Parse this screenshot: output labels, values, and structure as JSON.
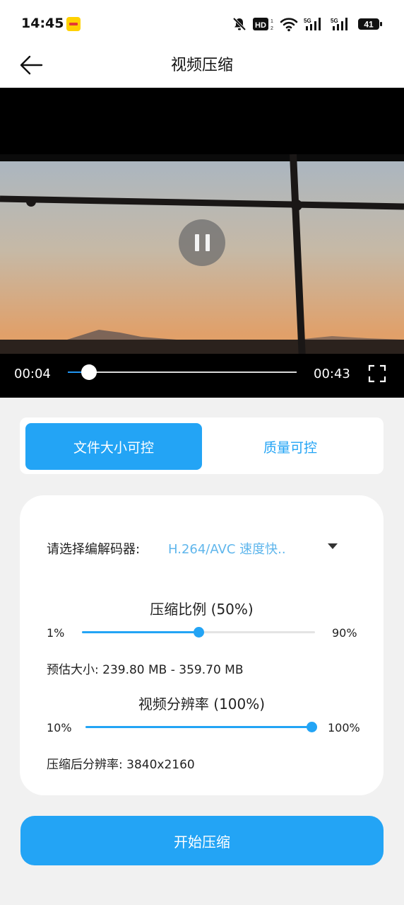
{
  "status_bar": {
    "time": "14:45",
    "app_badge_icon": "meituan-app-icon",
    "icons": [
      "mute-bell-icon",
      "hd-icon",
      "wifi-icon",
      "signal-5g-icon",
      "signal-5g-icon"
    ],
    "battery_level": "41"
  },
  "header": {
    "back_icon": "back-arrow-icon",
    "title": "视频压缩"
  },
  "player": {
    "current_time": "00:04",
    "total_time": "00:43",
    "progress_fraction": 0.093,
    "state_icon": "pause-icon",
    "fullscreen_icon": "fullscreen-icon"
  },
  "mode_tabs": [
    {
      "label": "文件大小可控",
      "active": true
    },
    {
      "label": "质量可控",
      "active": false
    }
  ],
  "codec": {
    "label": "请选择编解码器:",
    "value": "H.264/AVC 速度快..",
    "dropdown_icon": "dropdown-triangle-icon"
  },
  "compression": {
    "title": "压缩比例 (50%)",
    "min_label": "1%",
    "max_label": "90%",
    "value_fraction": 0.5,
    "estimate": "预估大小: 239.80 MB - 359.70 MB"
  },
  "resolution": {
    "title": "视频分辨率 (100%)",
    "min_label": "10%",
    "max_label": "100%",
    "value_fraction": 1.0,
    "result": "压缩后分辨率: 3840x2160"
  },
  "start_button": {
    "label": "开始压缩"
  },
  "colors": {
    "accent": "#23a4f5",
    "background": "#f1f1f1",
    "card": "#ffffff"
  }
}
